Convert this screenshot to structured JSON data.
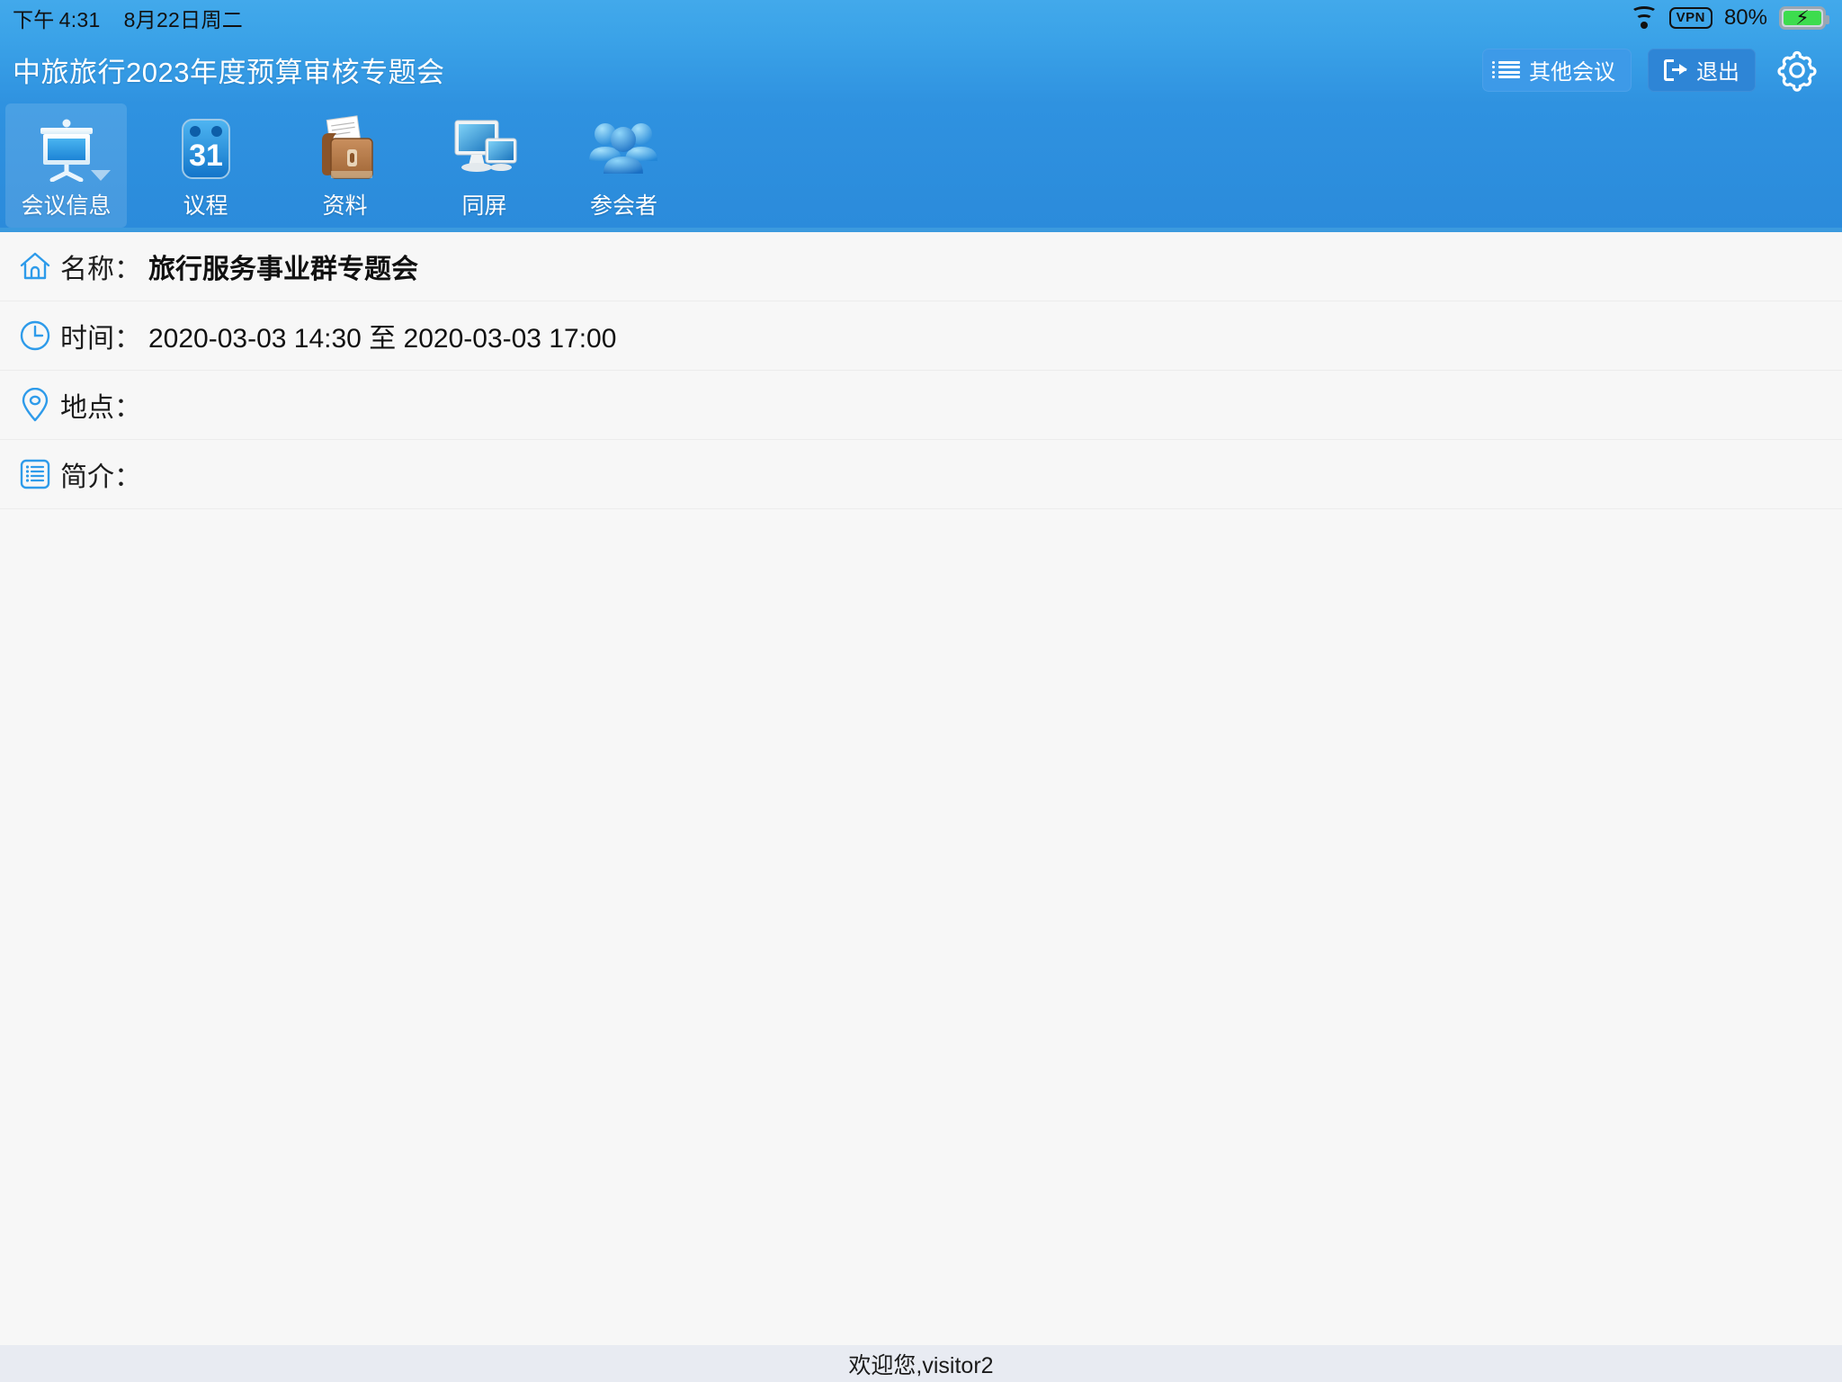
{
  "statusbar": {
    "time_period": "下午",
    "time": "4:31",
    "date": "8月22日周二",
    "vpn": "VPN",
    "battery_percent": "80%"
  },
  "header": {
    "title": "中旅旅行2023年度预算审核专题会",
    "other_meetings_label": "其他会议",
    "exit_label": "退出"
  },
  "tabs": [
    {
      "label": "会议信息",
      "icon": "presentation-screen-icon",
      "active": true
    },
    {
      "label": "议程",
      "icon": "calendar-31-icon",
      "active": false
    },
    {
      "label": "资料",
      "icon": "briefcase-documents-icon",
      "active": false
    },
    {
      "label": "同屏",
      "icon": "dual-monitor-icon",
      "active": false
    },
    {
      "label": "参会者",
      "icon": "people-group-icon",
      "active": false
    }
  ],
  "calendar_icon_day": "31",
  "meeting": {
    "rows": [
      {
        "icon": "home-icon",
        "label": "名称：",
        "value": "旅行服务事业群专题会",
        "bold": true
      },
      {
        "icon": "clock-icon",
        "label": "时间：",
        "value": "2020-03-03 14:30 至 2020-03-03 17:00",
        "bold": false
      },
      {
        "icon": "location-pin-icon",
        "label": "地点：",
        "value": "",
        "bold": false
      },
      {
        "icon": "document-list-icon",
        "label": "简介：",
        "value": "",
        "bold": false
      }
    ]
  },
  "footer": {
    "welcome_text": "欢迎您,visitor2"
  },
  "colors": {
    "status_blue": "#42a9eb",
    "header_blue": "#3ba3e8",
    "tabbar_blue": "#2f92e0",
    "accent_icon_blue": "#2e9bea",
    "content_bg": "#f7f7f7",
    "footer_bg": "#e8ebf2",
    "battery_green": "#3ddc4e"
  }
}
